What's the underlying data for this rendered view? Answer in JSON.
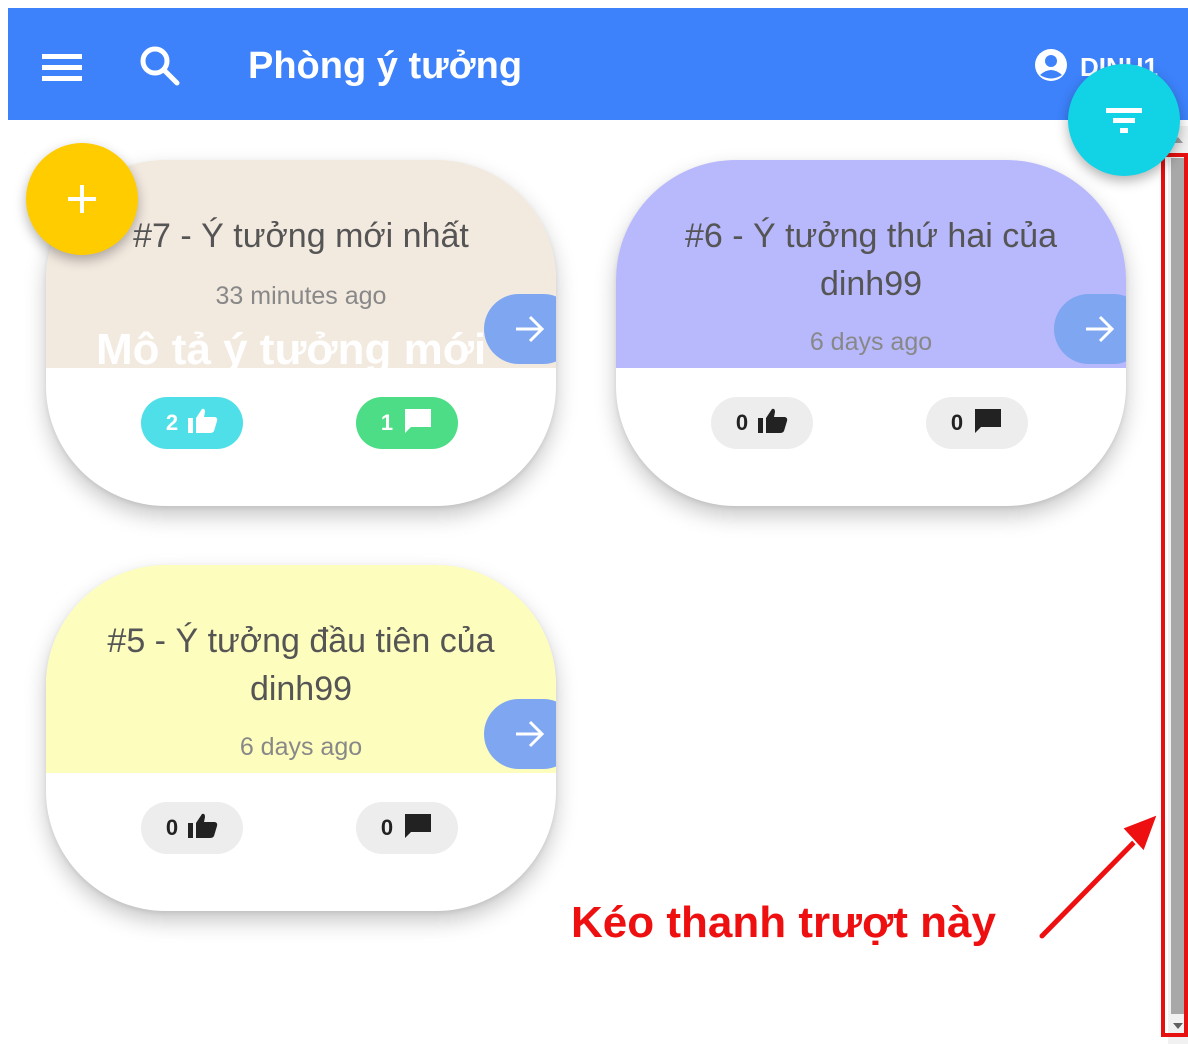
{
  "appbar": {
    "title": "Phòng ý tưởng",
    "user_name": "DINH1"
  },
  "colors": {
    "appbar": "#3d82fb",
    "fab_add": "#ffcc00",
    "fab_filter": "#12d2e6",
    "card_7": "#f2e9df",
    "card_6": "#b8b8fc",
    "card_5": "#fdfdbe",
    "arrow_button": "#7fa6f0",
    "chip_likes_active": "#4fdfe8",
    "chip_comments_active": "#4ddd86",
    "chip_default": "#ededed",
    "annotation": "#ee1010"
  },
  "cards": [
    {
      "title": "#7 - Ý tưởng mới nhất",
      "time": "33 minutes ago",
      "description": "Mô tả ý tưởng mới",
      "likes": "2",
      "comments": "1"
    },
    {
      "title": "#6 - Ý tưởng thứ hai của dinh99",
      "time": "6 days ago",
      "likes": "0",
      "comments": "0"
    },
    {
      "title": "#5 - Ý tưởng đầu tiên của dinh99",
      "time": "6 days ago",
      "likes": "0",
      "comments": "0"
    }
  ],
  "annotation": {
    "text": "Kéo thanh trượt này"
  }
}
